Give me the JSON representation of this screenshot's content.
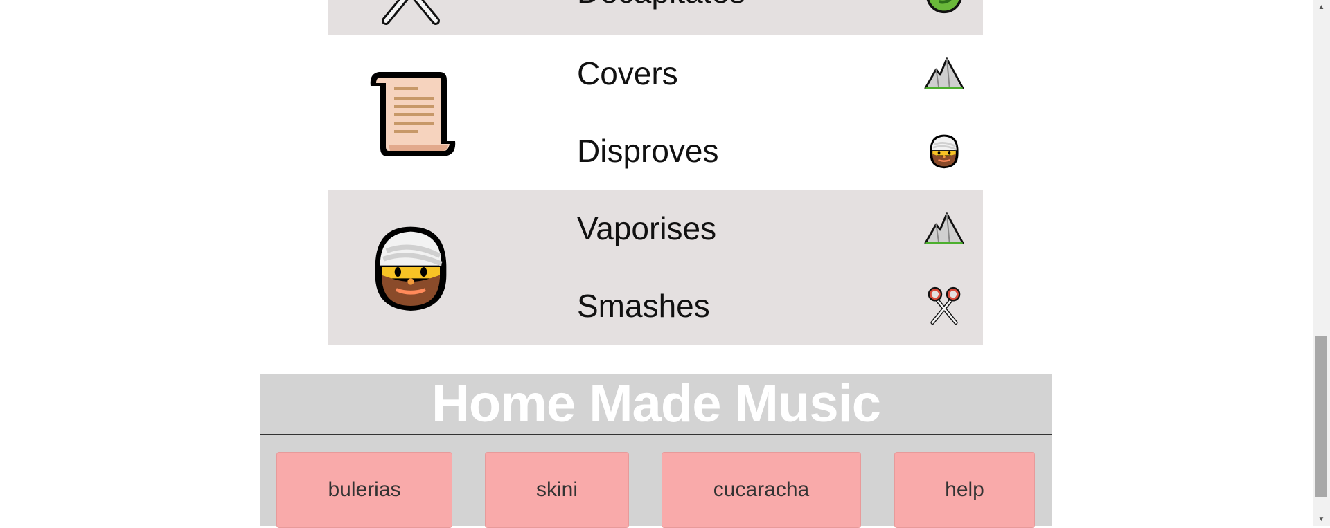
{
  "rules": [
    {
      "actor_icon": "scissors-icon",
      "verbs": [
        {
          "label": "Decapitates",
          "target_icon": "lizard-icon"
        }
      ]
    },
    {
      "actor_icon": "paper-scroll-icon",
      "verbs": [
        {
          "label": "Covers",
          "target_icon": "rock-mountain-icon"
        },
        {
          "label": "Disproves",
          "target_icon": "spock-person-icon"
        }
      ]
    },
    {
      "actor_icon": "spock-person-icon",
      "verbs": [
        {
          "label": "Vaporises",
          "target_icon": "rock-mountain-icon"
        },
        {
          "label": "Smashes",
          "target_icon": "scissors-icon"
        }
      ]
    }
  ],
  "footer": {
    "title": "Home Made Music",
    "nav": [
      "bulerias",
      "skini",
      "cucaracha",
      "help"
    ]
  },
  "colors": {
    "row_shade": "#e4e0e0",
    "footer_bg": "#d3d3d3",
    "nav_button": "#f9aaaa"
  }
}
